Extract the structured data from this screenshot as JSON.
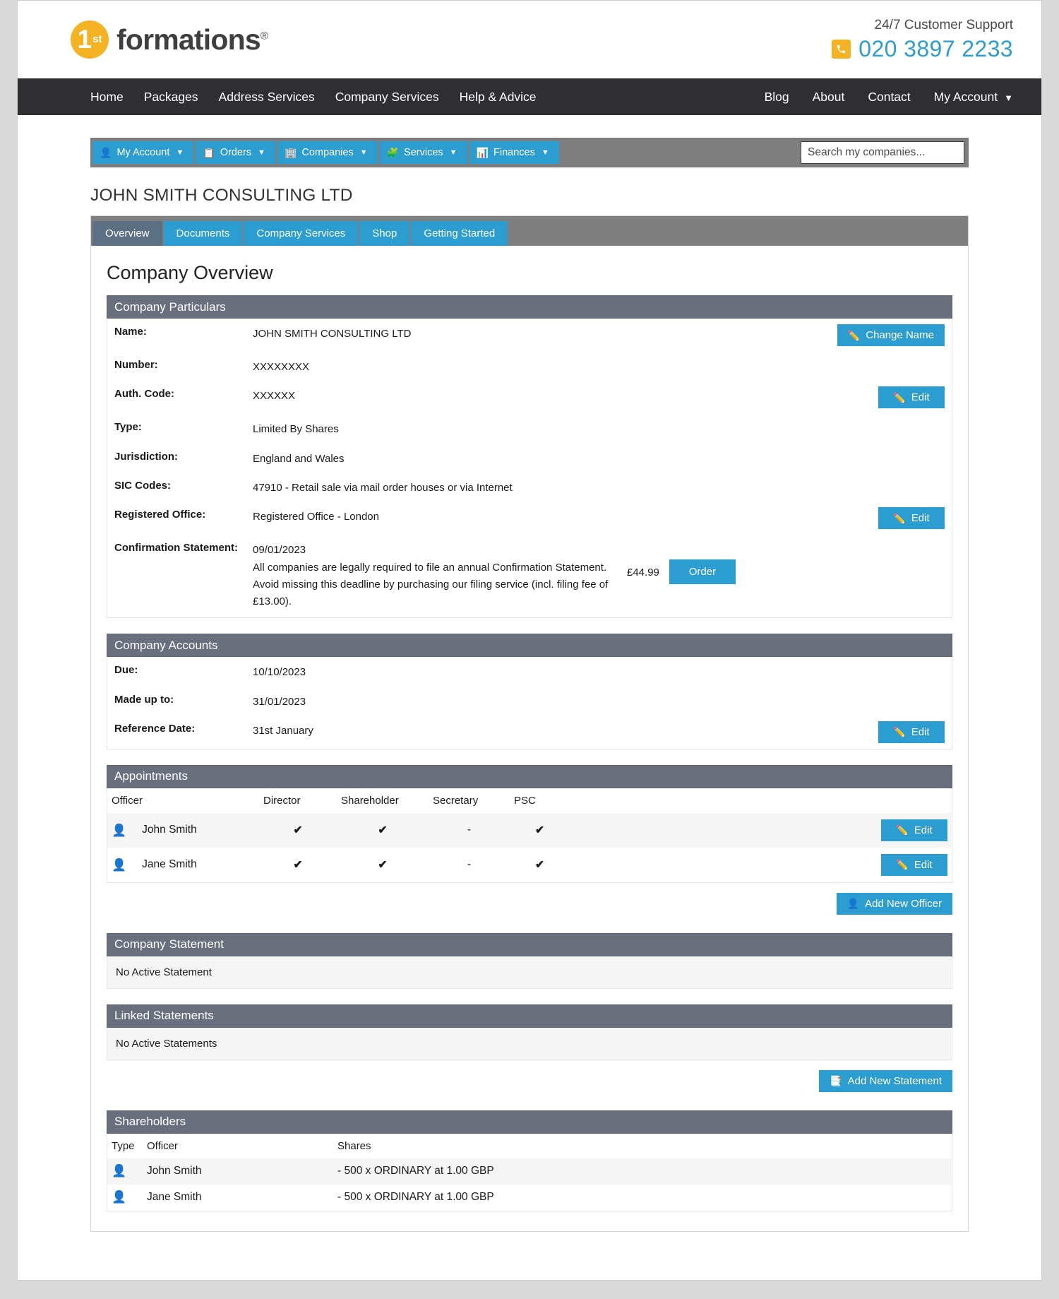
{
  "header": {
    "logo": {
      "badge_number": "1",
      "badge_suffix": "st",
      "word": "formations",
      "registered_mark": "®"
    },
    "support_label": "24/7 Customer Support",
    "support_number": "020 3897 2233",
    "phone_icon": "phone-icon"
  },
  "main_nav": {
    "left": [
      "Home",
      "Packages",
      "Address Services",
      "Company Services",
      "Help & Advice"
    ],
    "right": [
      "Blog",
      "About",
      "Contact"
    ],
    "account": "My Account",
    "account_chevron": "▼"
  },
  "toolbar": {
    "buttons": [
      {
        "label": "My Account",
        "icon": "user-icon",
        "glyph": "👤",
        "caret": "▼"
      },
      {
        "label": "Orders",
        "icon": "clipboard-icon",
        "glyph": "📋",
        "caret": "▼"
      },
      {
        "label": "Companies",
        "icon": "building-icon",
        "glyph": "🏢",
        "caret": "▼"
      },
      {
        "label": "Services",
        "icon": "puzzle-icon",
        "glyph": "🧩",
        "caret": "▼"
      },
      {
        "label": "Finances",
        "icon": "chart-icon",
        "glyph": "📊",
        "caret": "▼"
      }
    ],
    "search_placeholder": "Search my companies..."
  },
  "company_title": "JOHN SMITH CONSULTING LTD",
  "tabs": [
    {
      "label": "Overview",
      "active": true
    },
    {
      "label": "Documents",
      "active": false
    },
    {
      "label": "Company Services",
      "active": false
    },
    {
      "label": "Shop",
      "active": false
    },
    {
      "label": "Getting Started",
      "active": false
    }
  ],
  "page_heading": "Company Overview",
  "company_particulars": {
    "heading": "Company Particulars",
    "rows": [
      {
        "label": "Name:",
        "value": "JOHN SMITH CONSULTING LTD",
        "action": "Change Name",
        "action_icon": "pencil-icon"
      },
      {
        "label": "Number:",
        "value": "XXXXXXXX",
        "action": "",
        "action_icon": ""
      },
      {
        "label": "Auth. Code:",
        "value": "XXXXXX",
        "action": "Edit",
        "action_icon": "pencil-icon"
      },
      {
        "label": "Type:",
        "value": "Limited By Shares",
        "action": "",
        "action_icon": ""
      },
      {
        "label": "Jurisdiction:",
        "value": "England and Wales",
        "action": "",
        "action_icon": ""
      },
      {
        "label": "SIC Codes:",
        "value": "47910 - Retail sale via mail order houses or via Internet",
        "action": "",
        "action_icon": ""
      },
      {
        "label": "Registered Office:",
        "value": "Registered Office - London",
        "action": "Edit",
        "action_icon": "pencil-icon"
      },
      {
        "label": "Confirmation Statement:",
        "value": "09/01/2023",
        "action": "",
        "action_icon": ""
      }
    ],
    "confirmation_note": "All companies are legally required to file an annual Confirmation Statement. Avoid missing this deadline by purchasing our filing service (incl. filing fee of £13.00).",
    "confirmation_price": "£44.99",
    "confirmation_order_label": "Order"
  },
  "company_accounts": {
    "heading": "Company Accounts",
    "rows": [
      {
        "label": "Due:",
        "value": "10/10/2023"
      },
      {
        "label": "Made up to:",
        "value": "31/01/2023"
      },
      {
        "label": "Reference Date:",
        "value": "31st January"
      }
    ],
    "edit_label": "Edit",
    "edit_icon": "pencil-icon"
  },
  "appointments": {
    "heading": "Appointments",
    "columns": [
      "Officer",
      "Director",
      "Shareholder",
      "Secretary",
      "PSC",
      ""
    ],
    "rows": [
      {
        "officer": "John Smith",
        "avatar": "person-icon",
        "director": "✔",
        "shareholder": "✔",
        "secretary": "-",
        "psc": "✔",
        "action": "Edit",
        "action_icon": "pencil-icon"
      },
      {
        "officer": "Jane Smith",
        "avatar": "person-icon",
        "director": "✔",
        "shareholder": "✔",
        "secretary": "-",
        "psc": "✔",
        "action": "Edit",
        "action_icon": "pencil-icon"
      }
    ],
    "add_label": "Add New Officer",
    "add_icon": "add-person-icon"
  },
  "company_statement": {
    "heading": "Company Statement",
    "empty_text": "No Active Statement"
  },
  "linked_statements": {
    "heading": "Linked Statements",
    "empty_text": "No Active Statements",
    "add_label": "Add New Statement",
    "add_icon": "add-document-icon"
  },
  "shareholders": {
    "heading": "Shareholders",
    "columns": [
      "Type",
      "Officer",
      "Shares"
    ],
    "rows": [
      {
        "avatar": "person-icon",
        "officer": "John Smith",
        "shares": "- 500 x ORDINARY at 1.00 GBP"
      },
      {
        "avatar": "person-icon",
        "officer": "Jane Smith",
        "shares": "- 500 x ORDINARY at 1.00 GBP"
      }
    ]
  },
  "colors": {
    "accent_blue": "#2b9dd1",
    "brand_yellow": "#f5b323",
    "nav_dark": "#2e2e33",
    "section_gray": "#696f7c",
    "toolbar_gray": "#7f7f7f",
    "tick_green": "#5cb85c"
  }
}
